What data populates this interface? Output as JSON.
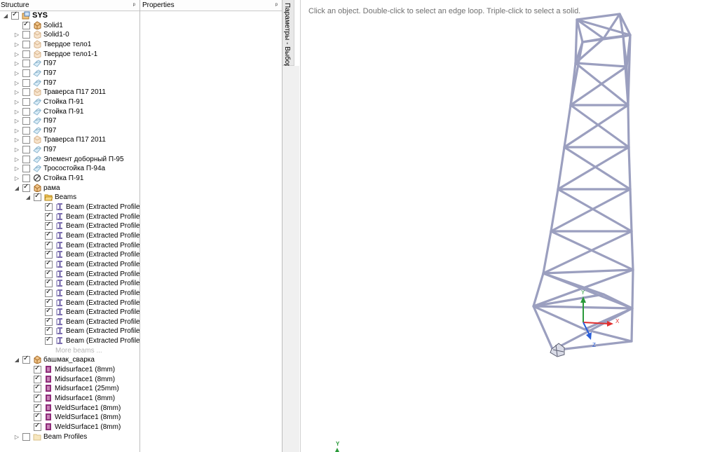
{
  "structure_panel": {
    "title": "Structure",
    "pin": "ᵖ"
  },
  "properties_panel": {
    "title": "Properties",
    "pin": "ᵖ"
  },
  "side_tab": {
    "label": "Параметры - Выбор"
  },
  "viewport": {
    "hint": "Click an object. Double-click to select an edge loop. Triple-click to select a solid."
  },
  "tree": [
    {
      "label": "SYS",
      "level": 0,
      "exp": "◢",
      "checked": true,
      "icon": "assembly",
      "bold": true
    },
    {
      "label": "Solid1",
      "level": 1,
      "exp": "",
      "checked": true,
      "icon": "solid"
    },
    {
      "label": "Solid1-0",
      "level": 1,
      "exp": "▷",
      "checked": false,
      "icon": "solid-faded"
    },
    {
      "label": "Твердое тело1",
      "level": 1,
      "exp": "▷",
      "checked": false,
      "icon": "solid-faded"
    },
    {
      "label": "Твердое тело1-1",
      "level": 1,
      "exp": "▷",
      "checked": false,
      "icon": "solid-faded"
    },
    {
      "label": "П97",
      "level": 1,
      "exp": "▷",
      "checked": false,
      "icon": "sheet-faded"
    },
    {
      "label": "П97",
      "level": 1,
      "exp": "▷",
      "checked": false,
      "icon": "sheet-faded"
    },
    {
      "label": "П97",
      "level": 1,
      "exp": "▷",
      "checked": false,
      "icon": "sheet-faded"
    },
    {
      "label": "Траверса П17 2011",
      "level": 1,
      "exp": "▷",
      "checked": false,
      "icon": "solid-faded"
    },
    {
      "label": "Стойка П-91",
      "level": 1,
      "exp": "▷",
      "checked": false,
      "icon": "sheet-faded"
    },
    {
      "label": "Стойка П-91",
      "level": 1,
      "exp": "▷",
      "checked": false,
      "icon": "sheet-faded"
    },
    {
      "label": "П97",
      "level": 1,
      "exp": "▷",
      "checked": false,
      "icon": "sheet-faded"
    },
    {
      "label": "П97",
      "level": 1,
      "exp": "▷",
      "checked": false,
      "icon": "sheet-faded"
    },
    {
      "label": "Траверса П17 2011",
      "level": 1,
      "exp": "▷",
      "checked": false,
      "icon": "solid-faded"
    },
    {
      "label": "П97",
      "level": 1,
      "exp": "▷",
      "checked": false,
      "icon": "sheet-faded"
    },
    {
      "label": "Элемент доборный П-95",
      "level": 1,
      "exp": "▷",
      "checked": false,
      "icon": "sheet-faded"
    },
    {
      "label": "Тросостойка П-94а",
      "level": 1,
      "exp": "▷",
      "checked": false,
      "icon": "sheet-faded"
    },
    {
      "label": "Стойка П-91",
      "level": 1,
      "exp": "▷",
      "checked": false,
      "icon": "blocked"
    },
    {
      "label": "рама",
      "level": 1,
      "exp": "◢",
      "checked": true,
      "icon": "solid"
    },
    {
      "label": "Beams",
      "level": 2,
      "exp": "◢",
      "checked": true,
      "icon": "folder-open"
    },
    {
      "label": "Beam (Extracted Profile",
      "level": 3,
      "exp": "",
      "checked": true,
      "icon": "beam"
    },
    {
      "label": "Beam (Extracted Profile",
      "level": 3,
      "exp": "",
      "checked": true,
      "icon": "beam"
    },
    {
      "label": "Beam (Extracted Profile",
      "level": 3,
      "exp": "",
      "checked": true,
      "icon": "beam"
    },
    {
      "label": "Beam (Extracted Profile",
      "level": 3,
      "exp": "",
      "checked": true,
      "icon": "beam"
    },
    {
      "label": "Beam (Extracted Profile",
      "level": 3,
      "exp": "",
      "checked": true,
      "icon": "beam"
    },
    {
      "label": "Beam (Extracted Profile",
      "level": 3,
      "exp": "",
      "checked": true,
      "icon": "beam"
    },
    {
      "label": "Beam (Extracted Profile",
      "level": 3,
      "exp": "",
      "checked": true,
      "icon": "beam"
    },
    {
      "label": "Beam (Extracted Profile",
      "level": 3,
      "exp": "",
      "checked": true,
      "icon": "beam"
    },
    {
      "label": "Beam (Extracted Profile",
      "level": 3,
      "exp": "",
      "checked": true,
      "icon": "beam"
    },
    {
      "label": "Beam (Extracted Profile",
      "level": 3,
      "exp": "",
      "checked": true,
      "icon": "beam"
    },
    {
      "label": "Beam (Extracted Profile",
      "level": 3,
      "exp": "",
      "checked": true,
      "icon": "beam"
    },
    {
      "label": "Beam (Extracted Profile",
      "level": 3,
      "exp": "",
      "checked": true,
      "icon": "beam"
    },
    {
      "label": "Beam (Extracted Profile",
      "level": 3,
      "exp": "",
      "checked": true,
      "icon": "beam"
    },
    {
      "label": "Beam (Extracted Profile",
      "level": 3,
      "exp": "",
      "checked": true,
      "icon": "beam"
    },
    {
      "label": "Beam (Extracted Profile",
      "level": 3,
      "exp": "",
      "checked": true,
      "icon": "beam"
    },
    {
      "label": "More beams ...",
      "level": 3,
      "exp": "",
      "checked": null,
      "icon": "none",
      "muted": true
    },
    {
      "label": "башмак_сварка",
      "level": 1,
      "exp": "◢",
      "checked": true,
      "icon": "solid"
    },
    {
      "label": "Midsurface1 (8mm)",
      "level": 2,
      "exp": "",
      "checked": true,
      "icon": "surface"
    },
    {
      "label": "Midsurface1 (8mm)",
      "level": 2,
      "exp": "",
      "checked": true,
      "icon": "surface"
    },
    {
      "label": "Midsurface1 (25mm)",
      "level": 2,
      "exp": "",
      "checked": true,
      "icon": "surface"
    },
    {
      "label": "Midsurface1 (8mm)",
      "level": 2,
      "exp": "",
      "checked": true,
      "icon": "surface"
    },
    {
      "label": "WeldSurface1 (8mm)",
      "level": 2,
      "exp": "",
      "checked": true,
      "icon": "surface"
    },
    {
      "label": "WeldSurface1 (8mm)",
      "level": 2,
      "exp": "",
      "checked": true,
      "icon": "surface"
    },
    {
      "label": "WeldSurface1 (8mm)",
      "level": 2,
      "exp": "",
      "checked": true,
      "icon": "surface"
    },
    {
      "label": "Beam Profiles",
      "level": 1,
      "exp": "▷",
      "checked": false,
      "icon": "folder-faded"
    }
  ],
  "triad": {
    "x": "X",
    "y": "Y",
    "z": "Z"
  },
  "origin_axis": {
    "y": "Y"
  },
  "colors": {
    "beam": "#9b9fbf",
    "axis_x": "#e03030",
    "axis_y": "#2a9a3a",
    "axis_z": "#2b5fd9",
    "hint": "#707070"
  }
}
